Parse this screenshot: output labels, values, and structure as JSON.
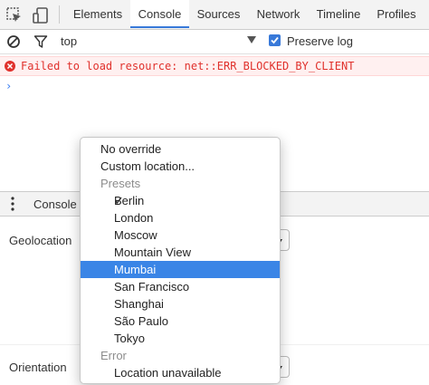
{
  "toolbar": {
    "tabs": [
      "Elements",
      "Console",
      "Sources",
      "Network",
      "Timeline",
      "Profiles"
    ],
    "active_tab": "Console"
  },
  "filter": {
    "context": "top",
    "preserve_log_label": "Preserve log",
    "preserve_log_checked": true
  },
  "console": {
    "error_message": "Failed to load resource: net::ERR_BLOCKED_BY_CLIENT",
    "prompt": "›"
  },
  "drawer": {
    "tab_label": "Console",
    "geolocation_label": "Geolocation",
    "orientation_label": "Orientation"
  },
  "menu": {
    "no_override": "No override",
    "custom_location": "Custom location...",
    "presets_header": "Presets",
    "presets": [
      "Berlin",
      "London",
      "Moscow",
      "Mountain View",
      "Mumbai",
      "San Francisco",
      "Shanghai",
      "São Paulo",
      "Tokyo"
    ],
    "checked_item": "Berlin",
    "highlighted_item": "Mumbai",
    "error_header": "Error",
    "error_items": [
      "Location unavailable"
    ]
  },
  "colors": {
    "accent": "#3879d9",
    "highlight": "#3a85e6",
    "error_text": "#e0312c",
    "error_bg": "#fff0f0"
  },
  "icons": [
    "inspect-icon",
    "device-icon",
    "clear-icon",
    "filter-icon",
    "error-icon",
    "checkmark-icon",
    "more-icon"
  ]
}
